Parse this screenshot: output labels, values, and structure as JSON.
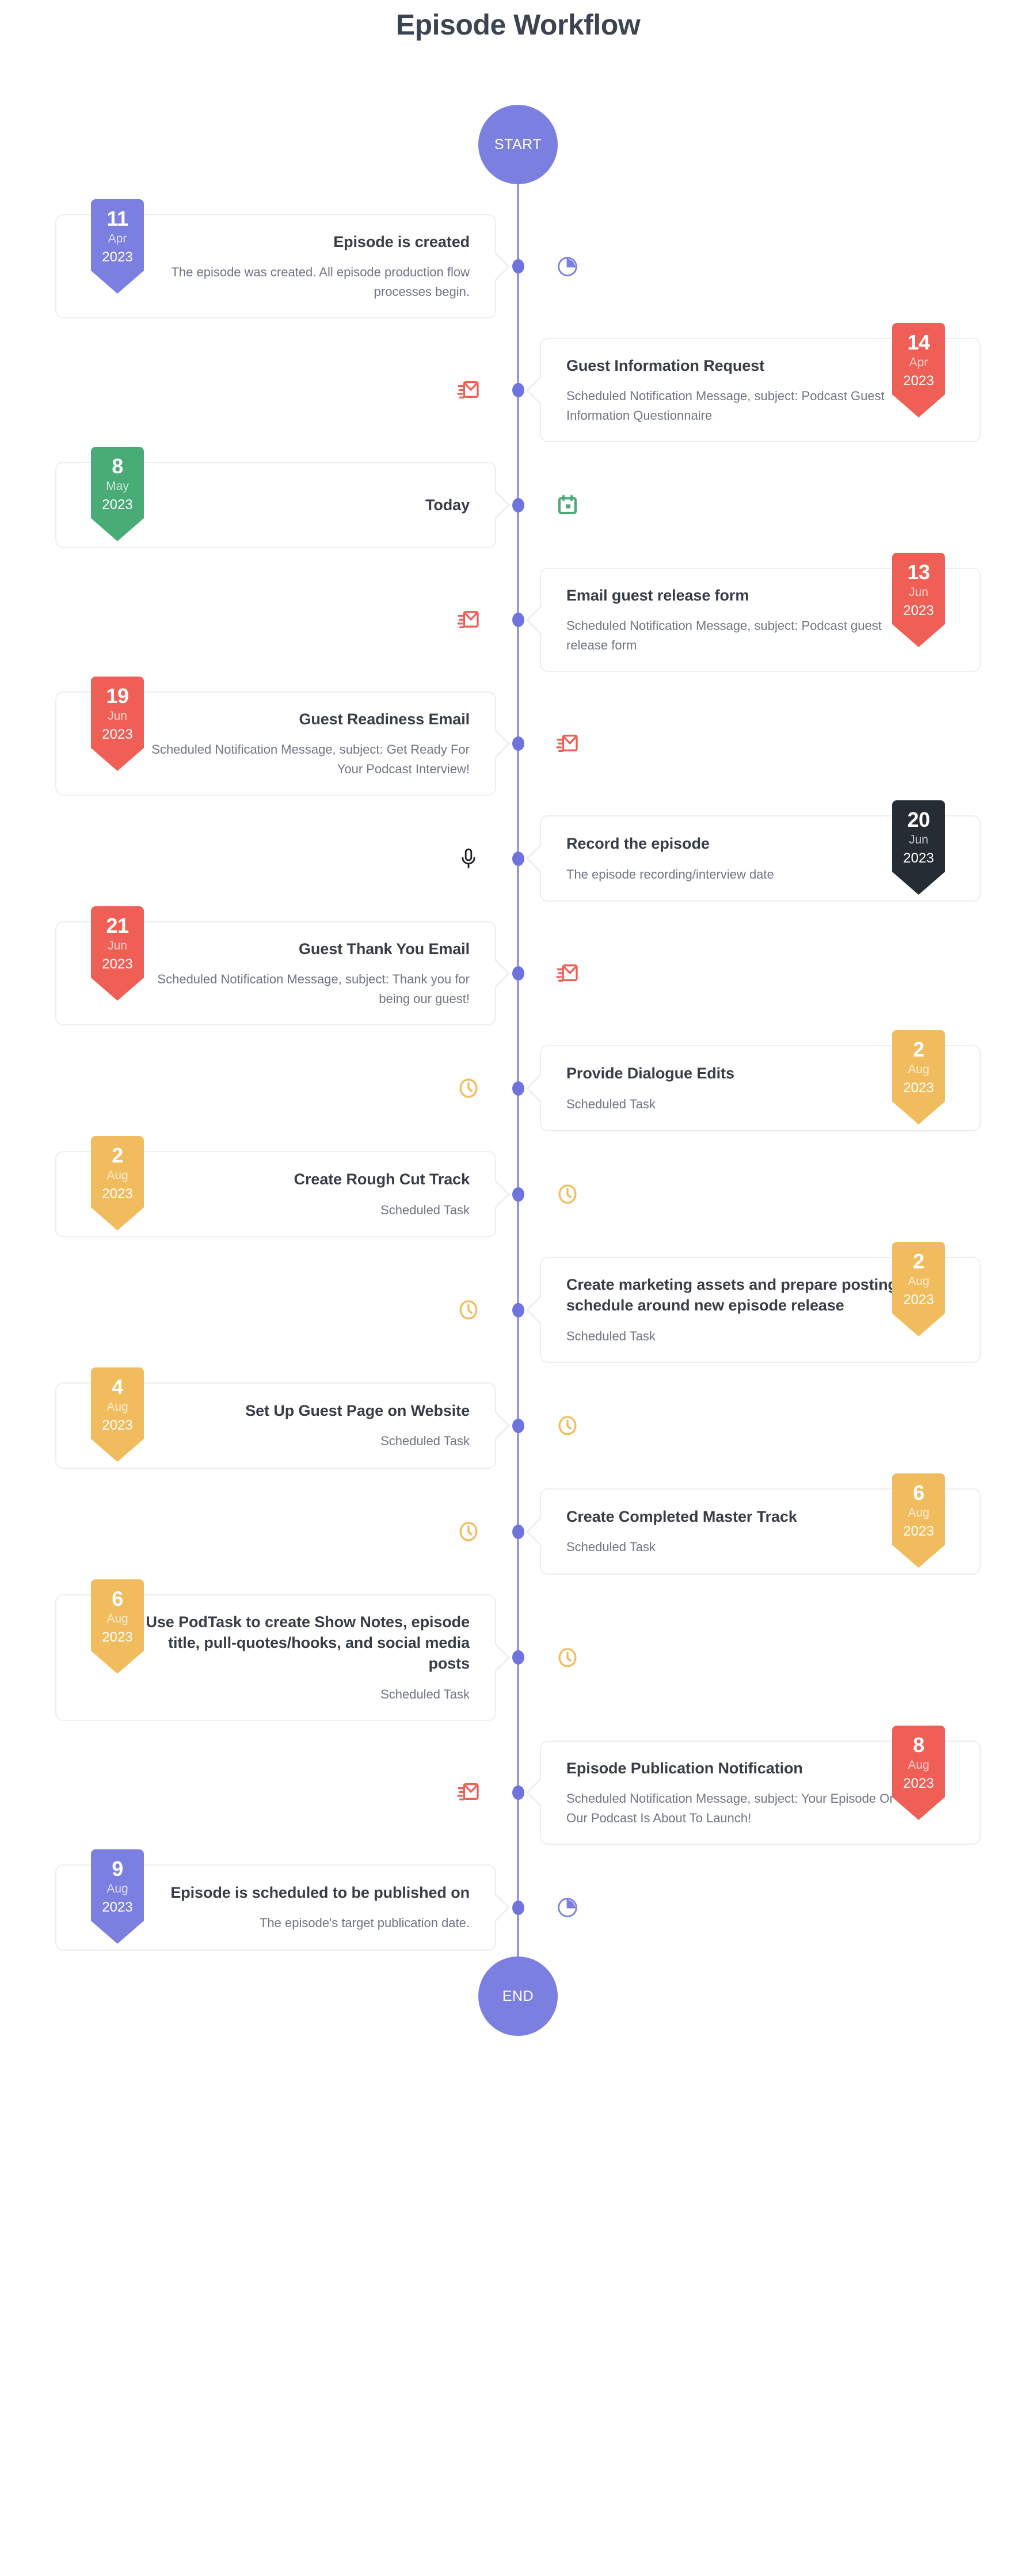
{
  "page": {
    "title": "Episode Workflow",
    "start_label": "START",
    "end_label": "END"
  },
  "colors": {
    "purple": "#7b7fe0",
    "green": "#49ac77",
    "red": "#ef5f55",
    "dark": "#262c33",
    "amber": "#f0bc5e",
    "axis": "#7b7fe0",
    "node_dot": "#6f74dd",
    "title_text": "#373d47",
    "desc_text": "#6f7487",
    "card_border": "#eceef1"
  },
  "events": [
    {
      "side": "left",
      "day": "11",
      "month": "Apr",
      "year": "2023",
      "color": "purple",
      "icon": "clock-pie-icon",
      "icon_color": "#7b7fe0",
      "title": "Episode is created",
      "desc": "The episode was created. All episode production flow processes begin."
    },
    {
      "side": "right",
      "day": "14",
      "month": "Apr",
      "year": "2023",
      "color": "red",
      "icon": "email-send-icon",
      "icon_color": "#ef5f55",
      "title": "Guest Information Request",
      "desc": "Scheduled Notification Message, subject: Podcast Guest Information Questionnaire"
    },
    {
      "side": "left",
      "day": "8",
      "month": "May",
      "year": "2023",
      "color": "green",
      "icon": "calendar-icon",
      "icon_color": "#49ac77",
      "title": "Today",
      "desc": ""
    },
    {
      "side": "right",
      "day": "13",
      "month": "Jun",
      "year": "2023",
      "color": "red",
      "icon": "email-send-icon",
      "icon_color": "#ef5f55",
      "title": "Email guest release form",
      "desc": "Scheduled Notification Message, subject: Podcast guest release form"
    },
    {
      "side": "left",
      "day": "19",
      "month": "Jun",
      "year": "2023",
      "color": "red",
      "icon": "email-send-icon",
      "icon_color": "#ef5f55",
      "title": "Guest Readiness Email",
      "desc": "Scheduled Notification Message, subject: Get Ready For Your Podcast Interview!"
    },
    {
      "side": "right",
      "day": "20",
      "month": "Jun",
      "year": "2023",
      "color": "dark",
      "icon": "microphone-icon",
      "icon_color": "#1d2024",
      "title": "Record the episode",
      "desc": "The episode recording/interview date"
    },
    {
      "side": "left",
      "day": "21",
      "month": "Jun",
      "year": "2023",
      "color": "red",
      "icon": "email-send-icon",
      "icon_color": "#ef5f55",
      "title": "Guest Thank You Email",
      "desc": "Scheduled Notification Message, subject: Thank you for being our guest!"
    },
    {
      "side": "right",
      "day": "2",
      "month": "Aug",
      "year": "2023",
      "color": "amber",
      "icon": "clock-outline-icon",
      "icon_color": "#f0bc5e",
      "title": "Provide Dialogue Edits",
      "desc": "Scheduled Task"
    },
    {
      "side": "left",
      "day": "2",
      "month": "Aug",
      "year": "2023",
      "color": "amber",
      "icon": "clock-outline-icon",
      "icon_color": "#f0bc5e",
      "title": "Create Rough Cut Track",
      "desc": "Scheduled Task"
    },
    {
      "side": "right",
      "day": "2",
      "month": "Aug",
      "year": "2023",
      "color": "amber",
      "icon": "clock-outline-icon",
      "icon_color": "#f0bc5e",
      "title": "Create marketing assets and prepare posting schedule around new episode release",
      "desc": "Scheduled Task"
    },
    {
      "side": "left",
      "day": "4",
      "month": "Aug",
      "year": "2023",
      "color": "amber",
      "icon": "clock-outline-icon",
      "icon_color": "#f0bc5e",
      "title": "Set Up Guest Page on Website",
      "desc": "Scheduled Task"
    },
    {
      "side": "right",
      "day": "6",
      "month": "Aug",
      "year": "2023",
      "color": "amber",
      "icon": "clock-outline-icon",
      "icon_color": "#f0bc5e",
      "title": "Create Completed Master Track",
      "desc": "Scheduled Task"
    },
    {
      "side": "left",
      "day": "6",
      "month": "Aug",
      "year": "2023",
      "color": "amber",
      "icon": "clock-outline-icon",
      "icon_color": "#f0bc5e",
      "title": "Use PodTask to create Show Notes, episode title, pull-quotes/hooks, and social media posts",
      "desc": "Scheduled Task"
    },
    {
      "side": "right",
      "day": "8",
      "month": "Aug",
      "year": "2023",
      "color": "red",
      "icon": "email-send-icon",
      "icon_color": "#ef5f55",
      "title": "Episode Publication Notification",
      "desc": "Scheduled Notification Message, subject: Your Episode On Our Podcast Is About To Launch!"
    },
    {
      "side": "left",
      "day": "9",
      "month": "Aug",
      "year": "2023",
      "color": "purple",
      "icon": "clock-pie-icon",
      "icon_color": "#7b7fe0",
      "title": "Episode is scheduled to be published on",
      "desc": "The episode's target publication date."
    }
  ]
}
